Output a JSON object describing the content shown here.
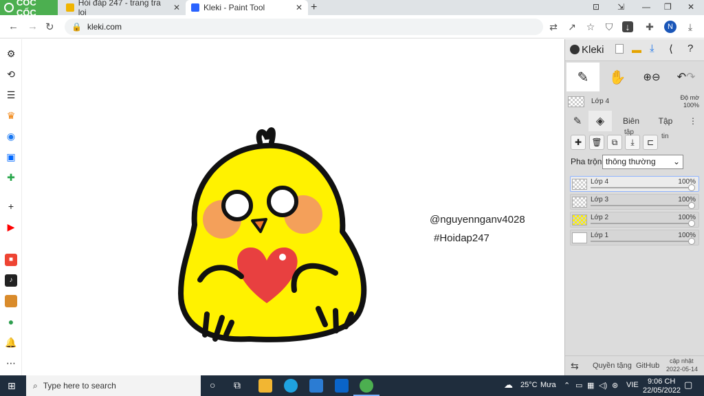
{
  "browser": {
    "brand": "CỐC CỐC",
    "tabs": [
      {
        "title": "Hỏi đáp 247 - trang tra loi",
        "favicon_color": "#f0b400"
      },
      {
        "title": "Kleki - Paint Tool",
        "favicon_color": "#2a63ff",
        "active": true
      }
    ],
    "url": "kleki.com",
    "avatar_letter": "N"
  },
  "canvas": {
    "handle1": "@nguyennganv4028",
    "handle2": "#Hoidap247"
  },
  "kleki": {
    "title": "Kleki",
    "layer_preview_name": "Lớp 4",
    "opacity_label": "Độ mờ",
    "opacity_value": "100%",
    "subtabs": [
      "Biên",
      "Tập"
    ],
    "layer_buttons_extra": [
      "tập",
      "tin"
    ],
    "blend_label": "Pha trộn",
    "blend_value": "thông thường",
    "layers": [
      {
        "name": "Lớp 4",
        "opacity": "100%",
        "active": true
      },
      {
        "name": "Lớp 3",
        "opacity": "100%"
      },
      {
        "name": "Lớp 2",
        "opacity": "100%"
      },
      {
        "name": "Lớp 1",
        "opacity": "100%"
      }
    ],
    "footer": {
      "quyen": "Quyền tặng",
      "github": "GitHub",
      "update_label": "cập nhật",
      "update_date": "2022-05-14"
    }
  },
  "taskbar": {
    "search_placeholder": "Type here to search",
    "weather": "25°C",
    "weather_desc": "Mưa",
    "lang": "VIE",
    "time": "9:06 CH",
    "date": "22/05/2022"
  },
  "colors": {
    "chick_yellow": "#fff200",
    "heart_red": "#e84040",
    "cheek_orange": "#f4a05a",
    "accent_blue": "#1a73e8"
  }
}
